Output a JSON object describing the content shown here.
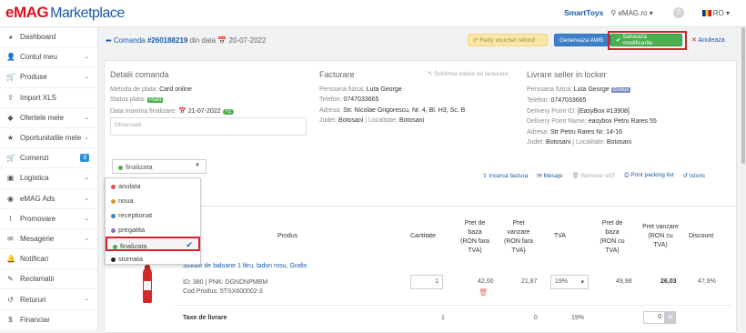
{
  "app": {
    "logo_brand": "eMAG",
    "logo_text": "Marketplace"
  },
  "topbar": {
    "shop": "SmartToys",
    "location": "eMAG.ro",
    "help": "?",
    "lang": "RO"
  },
  "sidebar": {
    "items": [
      {
        "label": "Dashboard",
        "icon": "dashboard-icon",
        "glyph": "◕"
      },
      {
        "label": "Contul meu",
        "icon": "user-icon",
        "glyph": "👤",
        "chevron": true
      },
      {
        "label": "Produse",
        "icon": "cart-icon",
        "glyph": "🛒",
        "chevron": true
      },
      {
        "label": "Import XLS",
        "icon": "upload-icon",
        "glyph": "⇪"
      },
      {
        "label": "Ofertele mele",
        "icon": "tag-icon",
        "glyph": "◆",
        "chevron": true
      },
      {
        "label": "Oportunitatile mele",
        "icon": "star-icon",
        "glyph": "★",
        "chevron": true
      },
      {
        "label": "Comenzi",
        "icon": "cart-icon",
        "glyph": "🛒",
        "badge": "3"
      },
      {
        "label": "Logistica",
        "icon": "box-icon",
        "glyph": "▣",
        "chevron": true
      },
      {
        "label": "eMAG Ads",
        "icon": "ads-icon",
        "glyph": "◉",
        "chevron": true
      },
      {
        "label": "Promovare",
        "icon": "chart-icon",
        "glyph": "⌇",
        "chevron": true
      },
      {
        "label": "Mesagerie",
        "icon": "mail-icon",
        "glyph": "✉",
        "chevron": true
      },
      {
        "label": "Notificari",
        "icon": "bell-icon",
        "glyph": "🔔"
      },
      {
        "label": "Reclamatii",
        "icon": "chat-icon",
        "glyph": "✎"
      },
      {
        "label": "Retururi",
        "icon": "return-icon",
        "glyph": "↺",
        "chevron": true
      },
      {
        "label": "Financiar",
        "icon": "money-icon",
        "glyph": "$"
      }
    ]
  },
  "header": {
    "back_label": "Comanda",
    "order_number": "#260188219",
    "date_prefix": "din data",
    "date": "20-07-2022",
    "retry_label": "Retry voucher refund",
    "awb_label": "Genereaza AWB",
    "save_label": "Salveaza modificarile",
    "cancel_label": "Anuleaza"
  },
  "details": {
    "title": "Detalii comanda",
    "payment_label": "Metoda de plata:",
    "payment_value": "Card online",
    "status_label": "Status plata:",
    "status_value": "Platit",
    "deadline_label": "Data maxima finalizare:",
    "deadline_value": "21-07-2022",
    "deadline_badge": "+1",
    "observatii": "Observatii"
  },
  "billing": {
    "title": "Facturare",
    "change": "Schimba datele de facturare",
    "person_label": "Persoana fizica:",
    "person_value": "Luta George",
    "phone_label": "Telefon:",
    "phone_value": "0747033665",
    "address_label": "Adresa:",
    "address_value": "Str. Nicolae Grigorescu, Nr. 4, Bl. H3, Sc. B",
    "county_label": "Judet:",
    "county_value": "Botosani",
    "city_label": "Localitate:",
    "city_value": "Botosani"
  },
  "locker": {
    "title": "Livrare seller in locker",
    "person_label": "Persoana fizica:",
    "person_value": "Luta George",
    "genius": "Genius",
    "phone_label": "Telefon:",
    "phone_value": "0747033665",
    "dp_id_label": "Delivery Point ID:",
    "dp_id_value": "[EasyBox #13908]",
    "dp_name_label": "Delivery Point Name:",
    "dp_name_value": "easybox Petru Rares 55",
    "address_label": "Adresa:",
    "address_value": "Str Petru Rares Nr. 14-16",
    "county_label": "Judet:",
    "county_value": "Botosani",
    "city_label": "Localitate:",
    "city_value": "Botosani"
  },
  "status_select": {
    "value": "finalizata",
    "color": "#4caf50"
  },
  "actions": {
    "invoice": "Incarca factura",
    "messages": "Mesaje",
    "remove_vat": "Remove VAT",
    "packing": "Print packing list",
    "history": "Istoric"
  },
  "dropdown": {
    "options": [
      {
        "label": "anulata",
        "color": "#d9534f"
      },
      {
        "label": "noua",
        "color": "#e8912d"
      },
      {
        "label": "receptionat",
        "color": "#3d80c9"
      },
      {
        "label": "pregatita",
        "color": "#8e6cc4"
      },
      {
        "label": "finalizata",
        "color": "#4caf50",
        "selected": true
      },
      {
        "label": "stornata",
        "color": "#222222"
      }
    ]
  },
  "table": {
    "headers": {
      "product": "Produs",
      "qty": "Cantitate",
      "base_price": [
        "Pret de",
        "baza",
        "(RON fara",
        "TVA)"
      ],
      "sale_price": [
        "Pret",
        "vanzare",
        "(RON fara",
        "TVA)"
      ],
      "tva": "TVA",
      "base_price_vat": [
        "Pret de",
        "baza",
        "(RON cu",
        "TVA)"
      ],
      "sale_price_vat": [
        "Pret vanzare",
        "(RON cu",
        "TVA)"
      ],
      "discount": "Discount"
    },
    "product": {
      "name": "Solutie de baloane 1 litru, bidon rosu, Grafix",
      "id_line": "ID: 380 | PNK: DGNDNPMBM",
      "code_line": "Cod Produs: 5TSX600002-2",
      "qty": "1",
      "base_price": "42,00",
      "sale_price": "21,87",
      "tva": "19%",
      "base_price_vat": "49,98",
      "sale_price_vat": "26,03",
      "discount": "47,9%"
    },
    "shipping": {
      "label": "Taxe de livrare",
      "qty": "1",
      "value": "0",
      "tva": "19%",
      "input": "0"
    }
  }
}
